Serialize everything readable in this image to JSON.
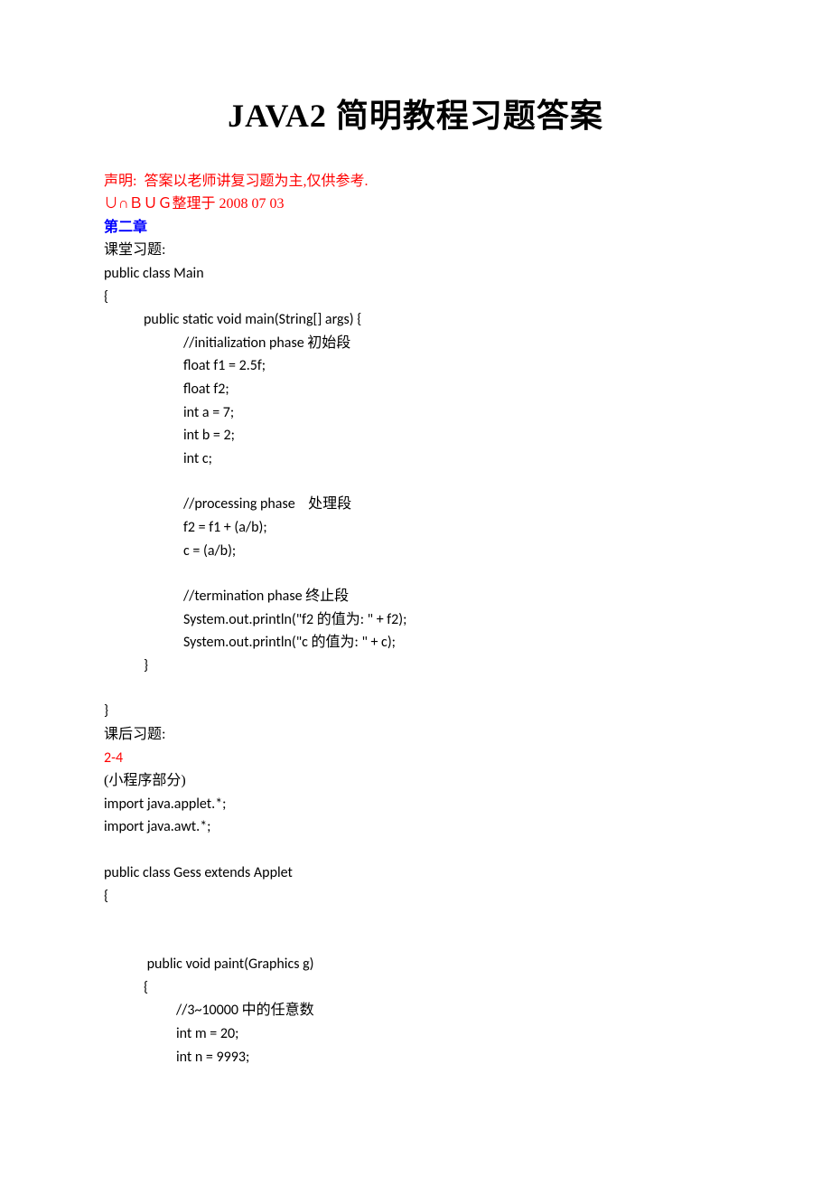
{
  "title": "JAVA2 简明教程习题答案",
  "disclaimer": "声明:  答案以老师讲复习题为主,仅供参考.",
  "author_note": "∪∩ＢＵＧ整理于 2008 07 03",
  "chapter": "第二章",
  "section1_label": "课堂习题:",
  "code1": {
    "l1": "public class Main",
    "l2": "{",
    "l3": "public static void main(String[] args) {",
    "l4": "//initialization phase 初始段",
    "l5": "float f1 = 2.5f;",
    "l6": "float f2;",
    "l7": "int a = 7;",
    "l8": "int b = 2;",
    "l9": "int c;",
    "l10": "//processing phase    处理段",
    "l11": "f2 = f1 + (a/b);",
    "l12": "c = (a/b);",
    "l13": "//termination phase 终止段",
    "l14": "System.out.println(\"f2 的值为: \" + f2);",
    "l15": "System.out.println(\"c 的值为: \" + c);",
    "l16": "}",
    "l17": "}"
  },
  "section2_label": "课后习题:",
  "exercise_num": "2-4",
  "applet_label": "(小程序部分)",
  "code2": {
    "l1": "import java.applet.*;",
    "l2": "import java.awt.*;",
    "l3": "public class Gess extends Applet",
    "l4": "{",
    "l5": " public void paint(Graphics g)",
    "l6": "{",
    "l7": "//3~10000 中的任意数",
    "l8": "int m = 20;",
    "l9": "int n = 9993;"
  }
}
